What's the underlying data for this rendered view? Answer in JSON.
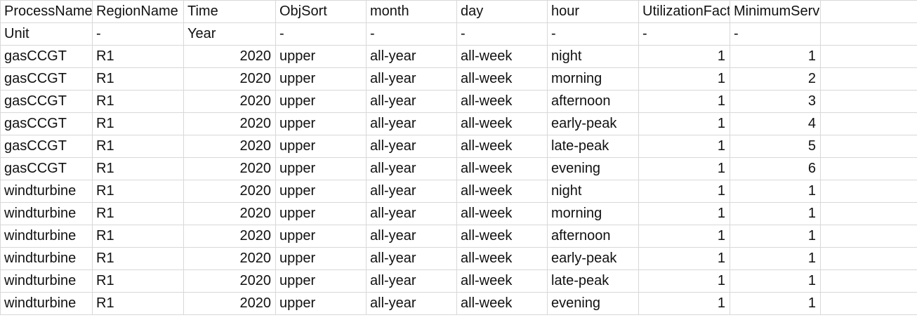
{
  "sheet": {
    "headers": [
      "ProcessName",
      "RegionName",
      "Time",
      "ObjSort",
      "month",
      "day",
      "hour",
      "UtilizationFactor",
      "MinimumServiceFactor",
      ""
    ],
    "units": [
      "Unit",
      "-",
      "Year",
      "-",
      "-",
      "-",
      "-",
      "-",
      "-",
      ""
    ],
    "rows": [
      [
        "gasCCGT",
        "R1",
        "2020",
        "upper",
        "all-year",
        "all-week",
        "night",
        "1",
        "1",
        ""
      ],
      [
        "gasCCGT",
        "R1",
        "2020",
        "upper",
        "all-year",
        "all-week",
        "morning",
        "1",
        "2",
        ""
      ],
      [
        "gasCCGT",
        "R1",
        "2020",
        "upper",
        "all-year",
        "all-week",
        "afternoon",
        "1",
        "3",
        ""
      ],
      [
        "gasCCGT",
        "R1",
        "2020",
        "upper",
        "all-year",
        "all-week",
        "early-peak",
        "1",
        "4",
        ""
      ],
      [
        "gasCCGT",
        "R1",
        "2020",
        "upper",
        "all-year",
        "all-week",
        "late-peak",
        "1",
        "5",
        ""
      ],
      [
        "gasCCGT",
        "R1",
        "2020",
        "upper",
        "all-year",
        "all-week",
        "evening",
        "1",
        "6",
        ""
      ],
      [
        "windturbine",
        "R1",
        "2020",
        "upper",
        "all-year",
        "all-week",
        "night",
        "1",
        "1",
        ""
      ],
      [
        "windturbine",
        "R1",
        "2020",
        "upper",
        "all-year",
        "all-week",
        "morning",
        "1",
        "1",
        ""
      ],
      [
        "windturbine",
        "R1",
        "2020",
        "upper",
        "all-year",
        "all-week",
        "afternoon",
        "1",
        "1",
        ""
      ],
      [
        "windturbine",
        "R1",
        "2020",
        "upper",
        "all-year",
        "all-week",
        "early-peak",
        "1",
        "1",
        ""
      ],
      [
        "windturbine",
        "R1",
        "2020",
        "upper",
        "all-year",
        "all-week",
        "late-peak",
        "1",
        "1",
        ""
      ],
      [
        "windturbine",
        "R1",
        "2020",
        "upper",
        "all-year",
        "all-week",
        "evening",
        "1",
        "1",
        ""
      ]
    ]
  }
}
